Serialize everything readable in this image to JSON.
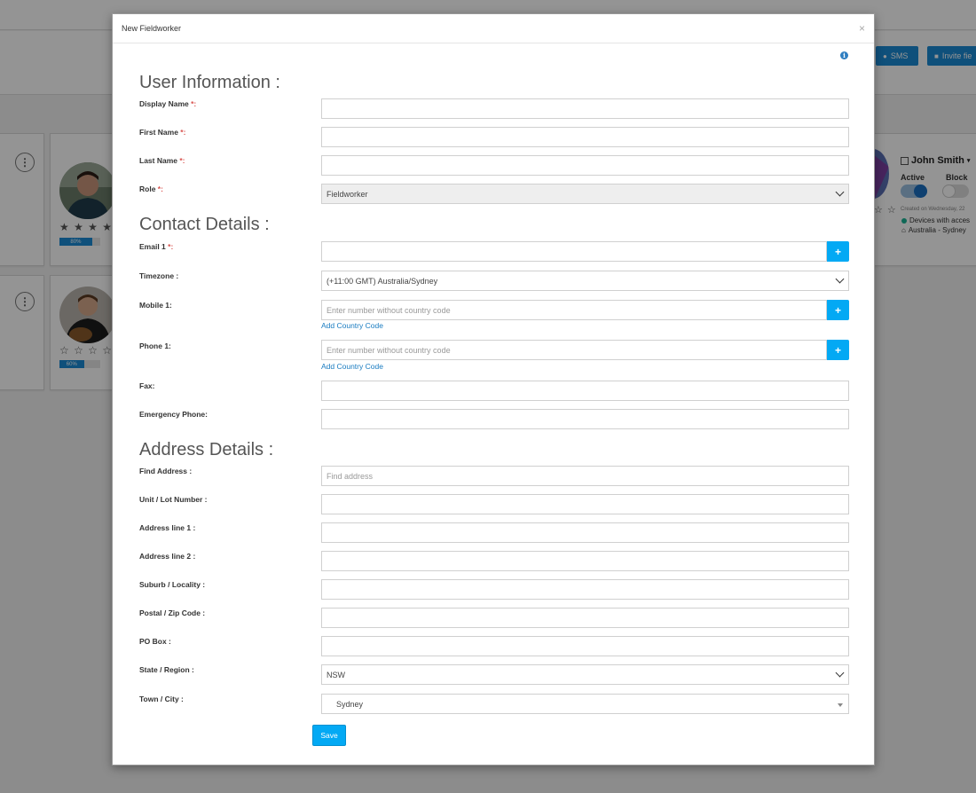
{
  "background": {
    "sms_button": "SMS",
    "invite_button": "Invite fie",
    "cards": [
      {
        "rating_stars": "★ ★ ★ ★ ★",
        "progress_label": "80%",
        "progress": 0.8
      },
      {
        "rating_stars": "☆ ☆ ☆ ☆ ☆",
        "progress_label": "60%",
        "progress": 0.6
      }
    ],
    "right_card": {
      "name": "John Smith",
      "active_label": "Active",
      "block_label": "Block",
      "created_text": "Created on Wednesday, 22",
      "devices_text": "Devices with acces",
      "location_text": "Australia - Sydney"
    }
  },
  "modal": {
    "title": "New Fieldworker",
    "close_glyph": "×",
    "info_glyph": "i",
    "sections": {
      "user": "User Information :",
      "contact": "Contact Details :",
      "address": "Address Details :"
    },
    "fields": {
      "display_name": {
        "label": "Display Name",
        "req": " *:",
        "value": ""
      },
      "first_name": {
        "label": "First Name",
        "req": " *:",
        "value": ""
      },
      "last_name": {
        "label": "Last Name",
        "req": " *:",
        "value": ""
      },
      "role": {
        "label": "Role",
        "req": " *:",
        "value": "Fieldworker"
      },
      "email": {
        "label": "Email 1",
        "req": " *:",
        "value": ""
      },
      "timezone": {
        "label": "Timezone :",
        "value": "(+11:00 GMT) Australia/Sydney"
      },
      "mobile": {
        "label": "Mobile 1:",
        "placeholder": "Enter number without country code",
        "link": "Add Country Code"
      },
      "phone": {
        "label": "Phone 1:",
        "placeholder": "Enter number without country code",
        "link": "Add Country Code"
      },
      "fax": {
        "label": "Fax:",
        "value": ""
      },
      "emergency_phone": {
        "label": "Emergency Phone:",
        "value": ""
      },
      "find_address": {
        "label": "Find Address :",
        "placeholder": "Find address"
      },
      "unit_lot": {
        "label": "Unit / Lot Number :",
        "value": ""
      },
      "address_line1": {
        "label": "Address line 1 :",
        "value": ""
      },
      "address_line2": {
        "label": "Address line 2 :",
        "value": ""
      },
      "suburb": {
        "label": "Suburb / Locality :",
        "value": ""
      },
      "postal": {
        "label": "Postal / Zip Code :",
        "value": ""
      },
      "po_box": {
        "label": "PO Box :",
        "value": ""
      },
      "state": {
        "label": "State / Region :",
        "value": "NSW"
      },
      "town": {
        "label": "Town / City :",
        "value": "Sydney"
      }
    },
    "plus_glyph": "+",
    "save_label": "Save"
  },
  "colors": {
    "accent": "#03a9f4",
    "brand_blue": "#1a8ad4",
    "required": "#d9534f",
    "link": "#1a7cc1"
  }
}
